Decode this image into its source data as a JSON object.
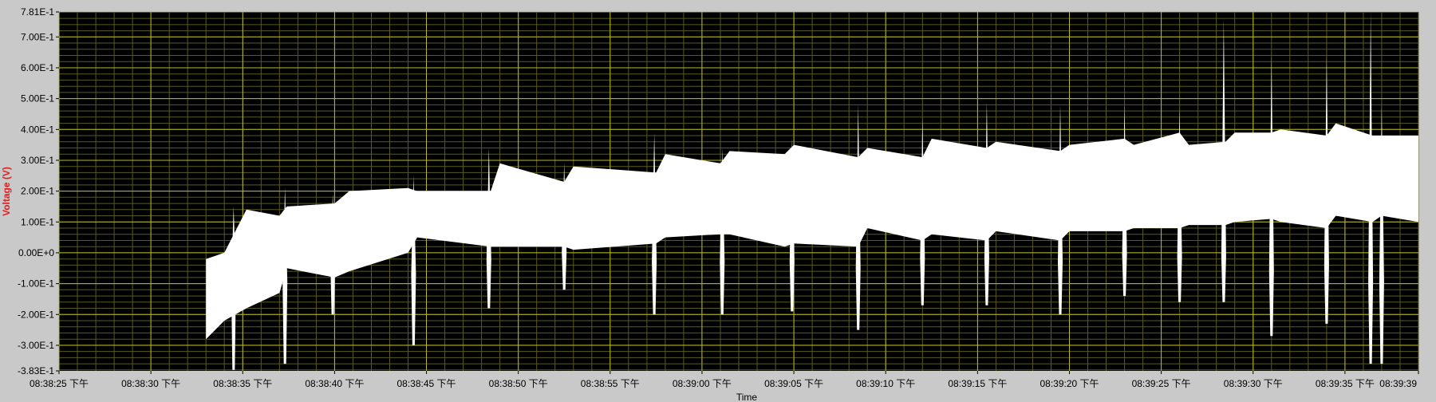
{
  "chart_data": {
    "type": "line",
    "ylabel": "Voltage (V)",
    "xlabel": "Time",
    "ylim": [
      -0.383,
      0.781
    ],
    "xlim": [
      "08:38:25",
      "08:39:39"
    ],
    "y_ticks": [
      "7.81E-1",
      "7.00E-1",
      "6.00E-1",
      "5.00E-1",
      "4.00E-1",
      "3.00E-1",
      "2.00E-1",
      "1.00E-1",
      "0.00E+0",
      "-1.00E-1",
      "-2.00E-1",
      "-3.00E-1",
      "-3.83E-1"
    ],
    "x_ticks": [
      "08:38:25 下午",
      "08:38:30 下午",
      "08:38:35 下午",
      "08:38:40 下午",
      "08:38:45 下午",
      "08:38:50 下午",
      "08:38:55 下午",
      "08:39:00 下午",
      "08:39:05 下午",
      "08:39:10 下午",
      "08:39:15 下午",
      "08:39:20 下午",
      "08:39:25 下午",
      "08:39:30 下午",
      "08:39:35 下午",
      "08:39:39"
    ],
    "grid": true,
    "colors": {
      "plot_bg": "#000000",
      "major_grid": "#b8b82a",
      "minor_grid": "#5a5a1e",
      "signal": "#ffffff",
      "ylabel": "#e0201f",
      "frame": "#c9c9c9"
    },
    "series": [
      {
        "envelope_x": [
          "08:38:33.0",
          "08:38:34.0",
          "08:38:35.2",
          "08:38:37.0",
          "08:38:37.4",
          "08:38:40.0",
          "08:38:40.8",
          "08:38:44.0",
          "08:38:44.5",
          "08:38:48.5",
          "08:38:49.0",
          "08:38:52.5",
          "08:38:53.0",
          "08:38:57.5",
          "08:38:58.0",
          "08:39:01.0",
          "08:39:01.5",
          "08:39:04.5",
          "08:39:05.0",
          "08:39:08.5",
          "08:39:09.0",
          "08:39:12.0",
          "08:39:12.5",
          "08:39:15.5",
          "08:39:16.0",
          "08:39:19.5",
          "08:39:20.0",
          "08:39:23.0",
          "08:39:23.5",
          "08:39:26.0",
          "08:39:26.5",
          "08:39:28.5",
          "08:39:29.0",
          "08:39:31.0",
          "08:39:31.5",
          "08:39:34.0",
          "08:39:34.5",
          "08:39:36.5",
          "08:39:37.0",
          "08:39:39.0"
        ],
        "envelope_max": [
          -0.02,
          0.0,
          0.14,
          0.12,
          0.15,
          0.16,
          0.2,
          0.21,
          0.2,
          0.2,
          0.29,
          0.23,
          0.28,
          0.26,
          0.32,
          0.29,
          0.33,
          0.32,
          0.35,
          0.31,
          0.34,
          0.31,
          0.37,
          0.34,
          0.36,
          0.33,
          0.35,
          0.37,
          0.35,
          0.39,
          0.35,
          0.36,
          0.39,
          0.39,
          0.4,
          0.38,
          0.42,
          0.38,
          0.38,
          0.38
        ],
        "envelope_min": [
          -0.28,
          -0.22,
          -0.18,
          -0.13,
          -0.05,
          -0.08,
          -0.06,
          0.0,
          0.05,
          0.02,
          0.02,
          0.02,
          0.01,
          0.03,
          0.05,
          0.06,
          0.06,
          0.02,
          0.03,
          0.02,
          0.08,
          0.04,
          0.06,
          0.04,
          0.07,
          0.04,
          0.07,
          0.07,
          0.08,
          0.08,
          0.09,
          0.09,
          0.1,
          0.11,
          0.1,
          0.08,
          0.12,
          0.1,
          0.12,
          0.1
        ],
        "spikes_x": [
          "08:38:34.5",
          "08:38:37.3",
          "08:38:39.9",
          "08:38:44.3",
          "08:38:48.4",
          "08:38:52.5",
          "08:38:57.4",
          "08:39:01.1",
          "08:39:04.9",
          "08:39:08.5",
          "08:39:12.0",
          "08:39:15.5",
          "08:39:19.5",
          "08:39:23.0",
          "08:39:26.0",
          "08:39:28.4",
          "08:39:31.0",
          "08:39:34.0",
          "08:39:36.4",
          "08:39:37.0"
        ],
        "spikes_max": [
          0.15,
          0.21,
          0.19,
          0.25,
          0.34,
          0.29,
          0.39,
          0.34,
          0.37,
          0.48,
          0.44,
          0.49,
          0.48,
          0.48,
          0.47,
          0.76,
          0.64,
          0.64,
          0.78,
          0.48
        ],
        "spikes_min": [
          -0.38,
          -0.36,
          -0.2,
          -0.3,
          -0.18,
          -0.12,
          -0.2,
          -0.2,
          -0.19,
          -0.25,
          -0.17,
          -0.17,
          -0.2,
          -0.14,
          -0.16,
          -0.16,
          -0.27,
          -0.23,
          -0.36,
          -0.36
        ]
      }
    ]
  }
}
